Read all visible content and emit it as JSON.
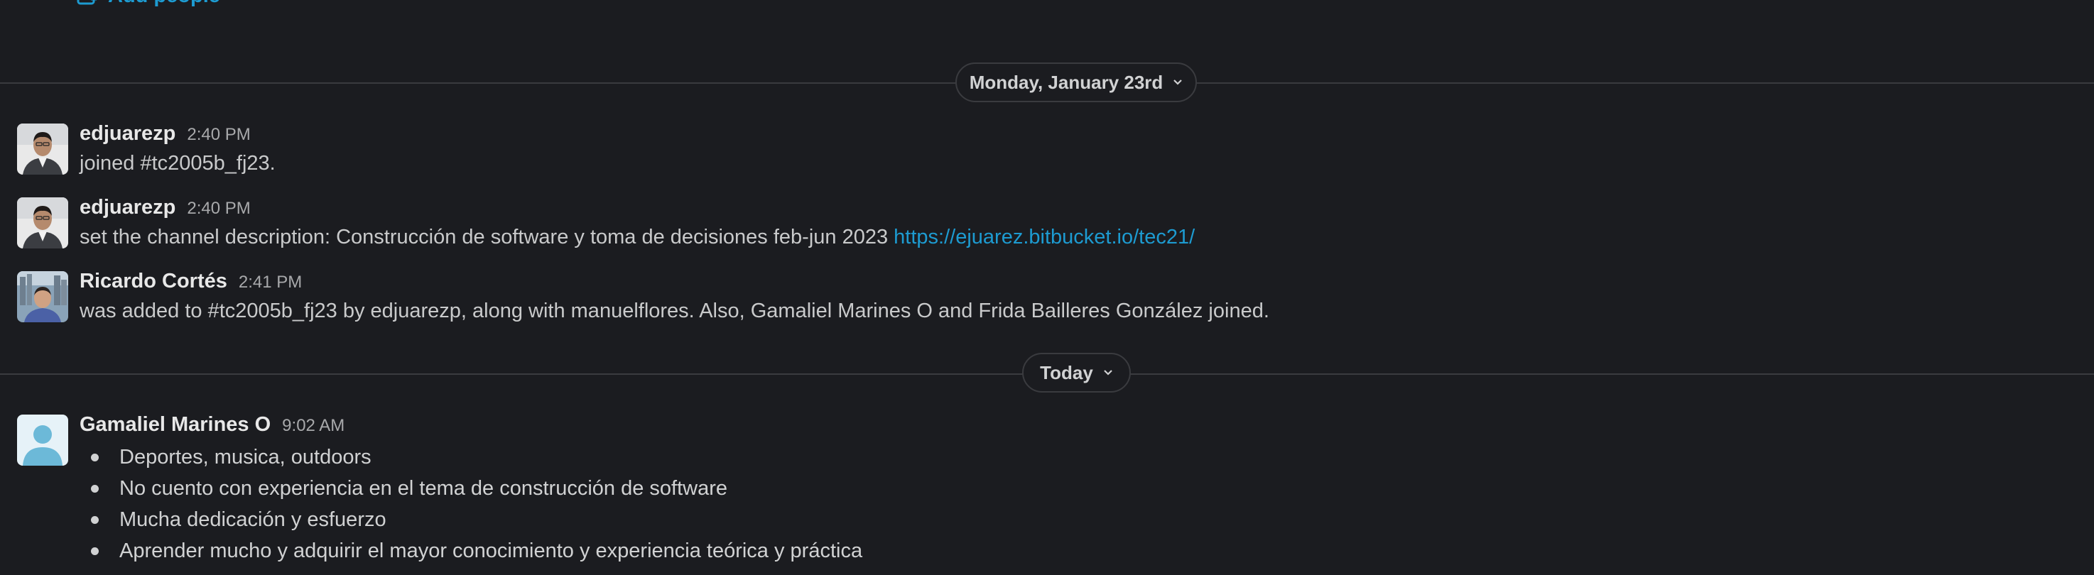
{
  "header": {
    "add_people_label": "Add people"
  },
  "dividers": [
    {
      "label": "Monday, January 23rd"
    },
    {
      "label": "Today"
    }
  ],
  "messages": [
    {
      "author": "edjuarezp",
      "time": "2:40 PM",
      "text": "joined #tc2005b_fj23."
    },
    {
      "author": "edjuarezp",
      "time": "2:40 PM",
      "text": "set the channel description: Construcción de software y toma de decisiones feb-jun 2023 ",
      "link": "https://ejuarez.bitbucket.io/tec21/"
    },
    {
      "author": "Ricardo Cortés",
      "time": "2:41 PM",
      "text": "was added to #tc2005b_fj23 by edjuarezp, along with manuelflores. Also, Gamaliel Marines O and Frida Bailleres González joined."
    },
    {
      "author": "Gamaliel Marines O",
      "time": "9:02 AM",
      "bullets": [
        "Deportes, musica, outdoors",
        "No cuento con experiencia en el tema de construcción de software",
        "Mucha dedicación y esfuerzo",
        "Aprender mucho y adquirir el mayor conocimiento y experiencia teórica y práctica"
      ]
    }
  ],
  "colors": {
    "background": "#1b1c20",
    "link": "#1d9bd1",
    "divider": "#3a3b3f",
    "text": "#d1d2d3"
  }
}
